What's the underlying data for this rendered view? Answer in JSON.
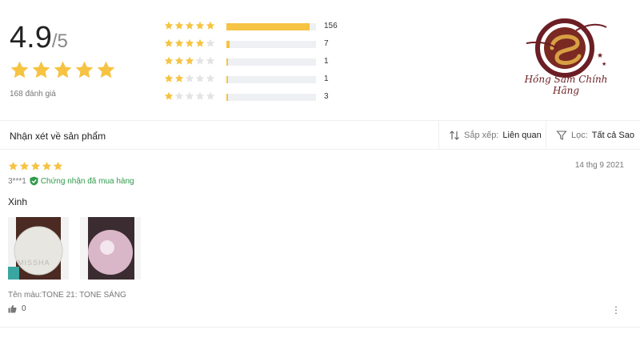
{
  "summary": {
    "score": "4.9",
    "score_max": "/5",
    "stars": 5,
    "review_count_label": "168 đánh giá"
  },
  "histogram": [
    {
      "stars": 5,
      "fraction": 0.93,
      "count": "156"
    },
    {
      "stars": 4,
      "fraction": 0.04,
      "count": "7"
    },
    {
      "stars": 3,
      "fraction": 0.01,
      "count": "1"
    },
    {
      "stars": 2,
      "fraction": 0.01,
      "count": "1"
    },
    {
      "stars": 1,
      "fraction": 0.02,
      "count": "3"
    }
  ],
  "brand": {
    "logo_text": "Hồng Sâm Chính Hãng"
  },
  "toolbar": {
    "title": "Nhận xét về sản phẩm",
    "sort_label": "Sắp xếp:",
    "sort_value": "Liên quan",
    "filter_label": "Lọc:",
    "filter_value": "Tất cả Sao"
  },
  "review": {
    "stars": 5,
    "date": "14 thg 9 2021",
    "user": "3***1",
    "verified_label": "Chứng nhận đã mua hàng",
    "text": "Xinh",
    "variant": "Tên màu:TONE 21: TONE SÁNG",
    "likes": "0"
  },
  "colors": {
    "star": "#f6c342",
    "star_empty": "#e3e3e3",
    "verified": "#2e9b4a",
    "logo": "#6b1e24"
  }
}
